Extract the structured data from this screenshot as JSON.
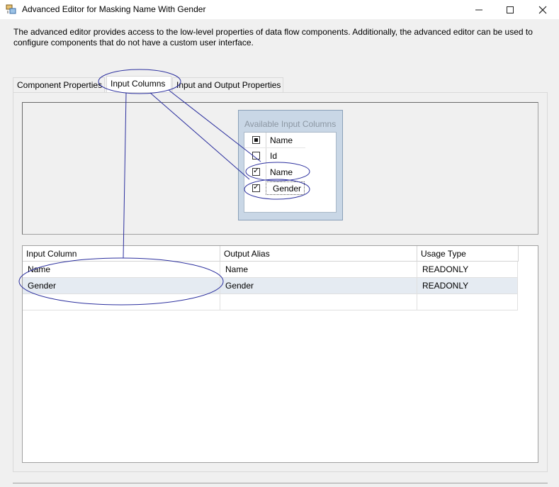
{
  "window": {
    "title": "Advanced Editor for Masking Name With Gender",
    "minimize_icon": "minimize-icon",
    "maximize_icon": "maximize-icon",
    "close_icon": "close-icon"
  },
  "description": "The advanced editor provides access to the low-level properties of data flow components. Additionally, the advanced editor can be used to configure components that do not have a custom user interface.",
  "tabs": [
    {
      "label": "Component Properties"
    },
    {
      "label": "Input Columns"
    },
    {
      "label": "Input and Output Properties"
    }
  ],
  "available_columns": {
    "title": "Available Input Columns",
    "header": "Name",
    "items": [
      {
        "label": "Id",
        "checked": false
      },
      {
        "label": "Name",
        "checked": true
      },
      {
        "label": "Gender",
        "checked": true
      }
    ]
  },
  "grid": {
    "headers": [
      "Input Column",
      "Output Alias",
      "Usage Type"
    ],
    "rows": [
      [
        "Name",
        "Name",
        "READONLY"
      ],
      [
        "Gender",
        "Gender",
        "READONLY"
      ]
    ]
  },
  "colors": {
    "annotation": "#2b2f9e",
    "selected_row": "#e5ebf2",
    "available_box": "#c9d7e6"
  }
}
